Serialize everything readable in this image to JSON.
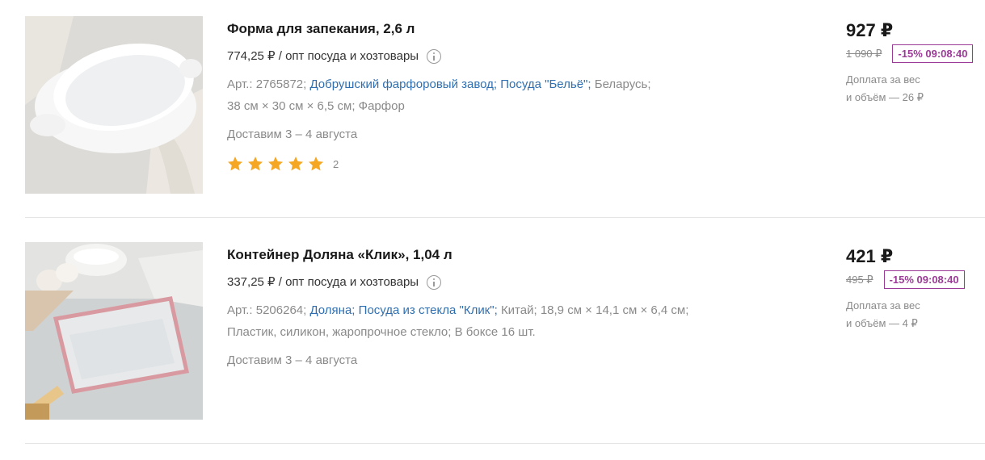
{
  "products": [
    {
      "title": "Форма для запекания, 2,6 л",
      "unit_price": "774,25 ₽ / опт посуда и хозтовары",
      "article": "Арт.: 2765872;",
      "manufacturer": "Добрушский фарфоровый завод;",
      "series": "Посуда \"Бельё\";",
      "country": "Беларусь;",
      "specs_line2": "38 см × 30 см × 6,5 см; Фарфор",
      "delivery": "Доставим 3 – 4 августа",
      "rating": 5,
      "review_count": "2",
      "price": "927 ₽",
      "old_price": "1 090 ₽",
      "discount": "-15% 09:08:40",
      "surcharge_line1": "Доплата за вес",
      "surcharge_line2": "и объём — 26 ₽"
    },
    {
      "title": "Контейнер Доляна «Клик», 1,04 л",
      "unit_price": "337,25 ₽ / опт посуда и хозтовары",
      "article": "Арт.: 5206264;",
      "manufacturer": "Доляна;",
      "series": "Посуда из стекла \"Клик\";",
      "country": "Китай;",
      "dimensions": "18,9 см × 14,1 см × 6,4 см;",
      "specs_line2": "Пластик, силикон, жаропрочное стекло; В боксе 16 шт.",
      "delivery": "Доставим 3 – 4 августа",
      "price": "421 ₽",
      "old_price": "495 ₽",
      "discount": "-15% 09:08:40",
      "surcharge_line1": "Доплата за вес",
      "surcharge_line2": "и объём — 4 ₽"
    }
  ],
  "colors": {
    "link": "#2f6fb1",
    "discount": "#9c3a97",
    "star": "#f5a623",
    "muted": "#8a8a8a"
  },
  "icons": [
    "info-icon",
    "star-icon"
  ]
}
